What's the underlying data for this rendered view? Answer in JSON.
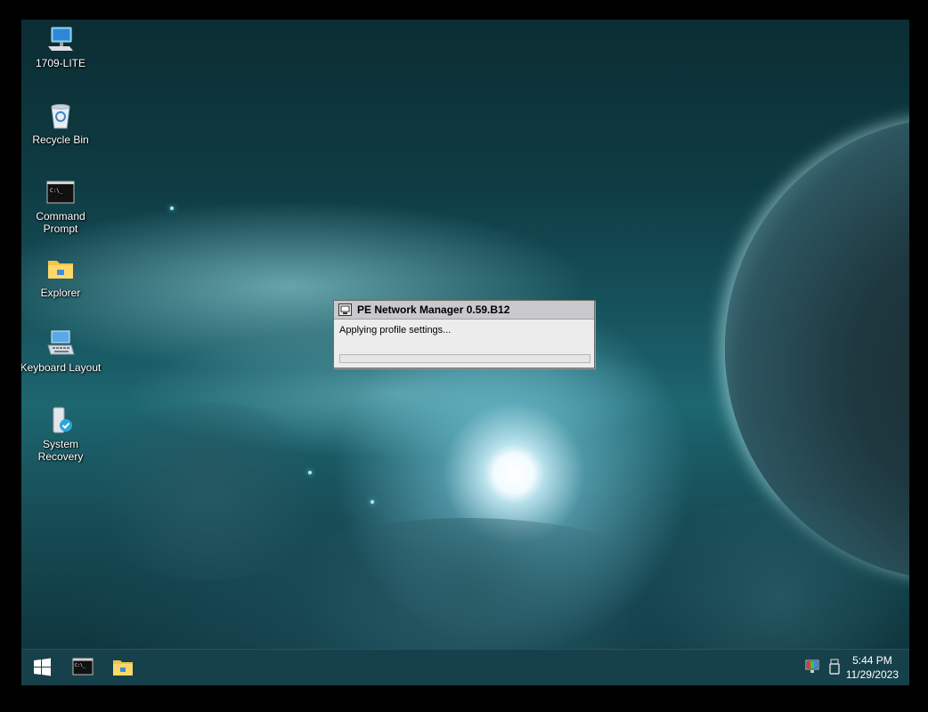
{
  "desktop": {
    "icons": [
      {
        "label": "1709-LITE",
        "icon": "computer-icon"
      },
      {
        "label": "Recycle Bin",
        "icon": "recycle-bin-icon"
      },
      {
        "label": "Command Prompt",
        "icon": "command-prompt-icon"
      },
      {
        "label": "Explorer",
        "icon": "folder-icon"
      },
      {
        "label": "Keyboard Layout",
        "icon": "keyboard-icon"
      },
      {
        "label": "System Recovery",
        "icon": "system-recovery-icon"
      }
    ]
  },
  "dialog": {
    "title": "PE Network Manager 0.59.B12",
    "message": "Applying profile settings...",
    "progress": 0
  },
  "taskbar": {
    "items": [
      "start-icon",
      "command-prompt-icon",
      "folder-icon"
    ],
    "tray": [
      "color-display-icon",
      "usb-drive-icon"
    ],
    "time": "5:44 PM",
    "date": "11/29/2023"
  }
}
